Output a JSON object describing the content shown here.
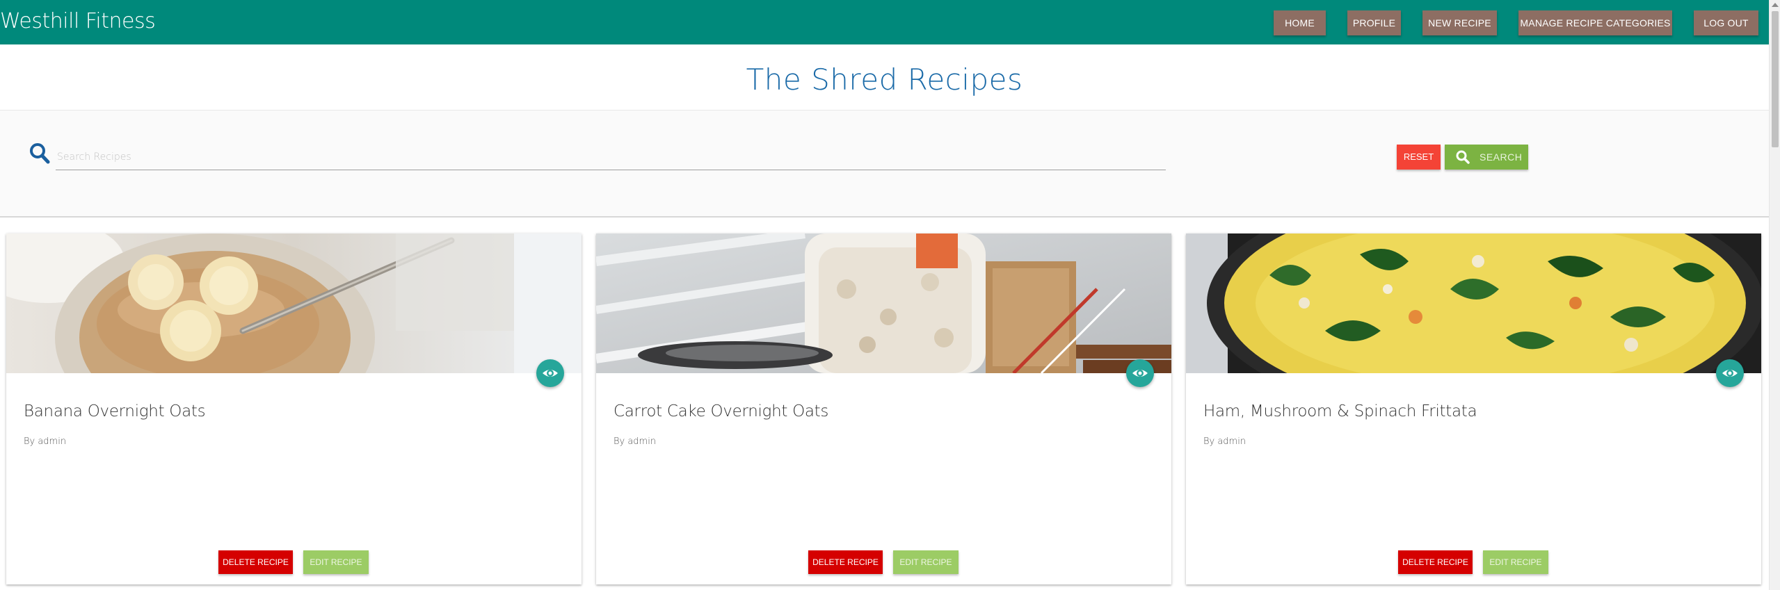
{
  "navbar": {
    "brand": "Westhill Fitness",
    "items": [
      {
        "label": "HOME"
      },
      {
        "label": "PROFILE"
      },
      {
        "label": "NEW RECIPE"
      },
      {
        "label": "MANAGE RECIPE CATEGORIES"
      },
      {
        "label": "LOG OUT"
      }
    ]
  },
  "page": {
    "title": "The Shred Recipes"
  },
  "search": {
    "placeholder": "Search Recipes",
    "value": "",
    "icon": "search-icon",
    "reset_label": "RESET",
    "search_label": "SEARCH"
  },
  "recipes": [
    {
      "title": "Banana Overnight Oats",
      "author": "By admin",
      "delete_label": "DELETE RECIPE",
      "edit_label": "EDIT RECIPE"
    },
    {
      "title": "Carrot Cake Overnight Oats",
      "author": "By admin",
      "delete_label": "DELETE RECIPE",
      "edit_label": "EDIT RECIPE"
    },
    {
      "title": "Ham, Mushroom & Spinach Frittata",
      "author": "By admin",
      "delete_label": "DELETE RECIPE",
      "edit_label": "EDIT RECIPE"
    }
  ],
  "colors": {
    "navbar": "#00897b",
    "nav_button": "#8d6e63",
    "title": "#1a6aa8",
    "reset": "#f44336",
    "search": "#7cb342",
    "delete": "#d50000",
    "edit": "#9ccc65",
    "view": "#26a69a"
  }
}
